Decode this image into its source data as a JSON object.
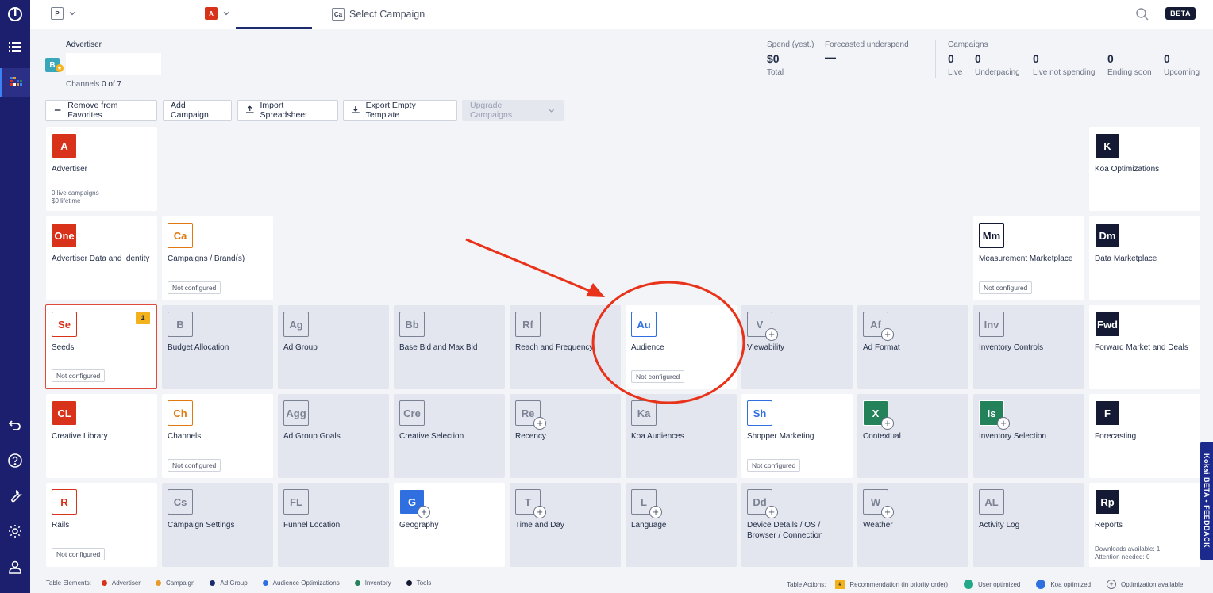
{
  "topbar": {
    "partner_chip": "P",
    "advertiser_chip": "A",
    "campaign_chip": "Ca",
    "campaign_placeholder": "Select Campaign",
    "beta": "BETA"
  },
  "advertiser": {
    "title": "Advertiser",
    "logo": "B",
    "channels_label": "Channels",
    "channels_count": "0 of 7"
  },
  "stats": {
    "spend_label": "Spend (yest.)",
    "spend_value": "$0",
    "spend_sub": "Total",
    "forecast_label": "Forecasted underspend",
    "forecast_value": "—",
    "campaigns_label": "Campaigns",
    "items": [
      {
        "value": "0",
        "label": "Live"
      },
      {
        "value": "0",
        "label": "Underpacing"
      },
      {
        "value": "0",
        "label": "Live not spending"
      },
      {
        "value": "0",
        "label": "Ending soon"
      },
      {
        "value": "0",
        "label": "Upcoming"
      }
    ]
  },
  "toolbar": {
    "remove_fav": "Remove from Favorites",
    "add_campaign": "Add Campaign",
    "import": "Import Spreadsheet",
    "export": "Export Empty Template",
    "upgrade": "Upgrade Campaigns"
  },
  "tiles": {
    "advertiser": {
      "sym": "A",
      "label": "Advertiser",
      "extra1": "0 live campaigns",
      "extra2": "$0 lifetime"
    },
    "koa_opt": {
      "sym": "K",
      "label": "Koa Optimizations"
    },
    "adv_data": {
      "sym": "One",
      "label": "Advertiser Data and Identity"
    },
    "campaigns_brand": {
      "sym": "Ca",
      "label": "Campaigns / Brand(s)",
      "badge": "Not configured"
    },
    "measurement": {
      "sym": "Mm",
      "label": "Measurement Marketplace",
      "badge": "Not configured"
    },
    "data_market": {
      "sym": "Dm",
      "label": "Data Marketplace"
    },
    "seeds": {
      "sym": "Se",
      "label": "Seeds",
      "badge": "Not configured",
      "rec": "1"
    },
    "budget_alloc": {
      "sym": "B",
      "label": "Budget Allocation"
    },
    "ad_group": {
      "sym": "Ag",
      "label": "Ad Group"
    },
    "base_bid": {
      "sym": "Bb",
      "label": "Base Bid and Max Bid"
    },
    "reach_freq": {
      "sym": "Rf",
      "label": "Reach and Frequency"
    },
    "audience": {
      "sym": "Au",
      "label": "Audience",
      "badge": "Not configured"
    },
    "viewability": {
      "sym": "V",
      "label": "Viewability"
    },
    "ad_format": {
      "sym": "Af",
      "label": "Ad Format"
    },
    "inventory_controls": {
      "sym": "Inv",
      "label": "Inventory Controls"
    },
    "forward_market": {
      "sym": "Fwd",
      "label": "Forward Market and Deals"
    },
    "creative_library": {
      "sym": "CL",
      "label": "Creative Library"
    },
    "channels": {
      "sym": "Ch",
      "label": "Channels",
      "badge": "Not configured"
    },
    "ad_group_goals": {
      "sym": "Agg",
      "label": "Ad Group Goals"
    },
    "creative_selection": {
      "sym": "Cre",
      "label": "Creative Selection"
    },
    "recency": {
      "sym": "Re",
      "label": "Recency"
    },
    "koa_audiences": {
      "sym": "Ka",
      "label": "Koa Audiences"
    },
    "shopper_marketing": {
      "sym": "Sh",
      "label": "Shopper Marketing",
      "badge": "Not configured"
    },
    "contextual": {
      "sym": "X",
      "label": "Contextual"
    },
    "inventory_selection": {
      "sym": "Is",
      "label": "Inventory Selection"
    },
    "forecasting": {
      "sym": "F",
      "label": "Forecasting"
    },
    "rails": {
      "sym": "R",
      "label": "Rails",
      "badge": "Not configured"
    },
    "campaign_settings": {
      "sym": "Cs",
      "label": "Campaign Settings"
    },
    "funnel_location": {
      "sym": "FL",
      "label": "Funnel Location"
    },
    "geography": {
      "sym": "G",
      "label": "Geography"
    },
    "time_day": {
      "sym": "T",
      "label": "Time and Day"
    },
    "language": {
      "sym": "L",
      "label": "Language"
    },
    "device_details": {
      "sym": "Dd",
      "label": "Device Details / OS / Browser / Connection"
    },
    "weather": {
      "sym": "W",
      "label": "Weather"
    },
    "activity_log": {
      "sym": "AL",
      "label": "Activity Log"
    },
    "reports": {
      "sym": "Rp",
      "label": "Reports",
      "extra1": "Downloads available: 1",
      "extra2": "Attention needed: 0"
    }
  },
  "legend": {
    "title": "Table Elements:",
    "items": [
      {
        "label": "Advertiser",
        "color": "#d9321a"
      },
      {
        "label": "Campaign",
        "color": "#e89a2a"
      },
      {
        "label": "Ad Group",
        "color": "#1c2a6e"
      },
      {
        "label": "Audience Optimizations",
        "color": "#2f6fe0"
      },
      {
        "label": "Inventory",
        "color": "#23825a"
      },
      {
        "label": "Tools",
        "color": "#141a33"
      }
    ],
    "actions_title": "Table Actions:",
    "rec_symbol": "#",
    "rec_label": "Recommendation (in priority order)",
    "user_label": "User optimized",
    "koa_label": "Koa optimized",
    "opt_label": "Optimization available"
  },
  "feedback": "Kokai BETA • FEEDBACK"
}
